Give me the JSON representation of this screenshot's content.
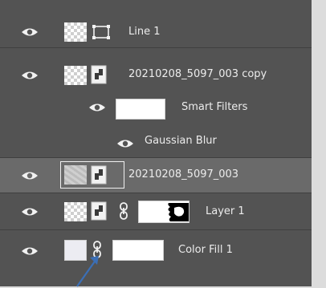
{
  "layers": [
    {
      "name": "Line 1"
    },
    {
      "name": "20210208_5097_003 copy"
    },
    {
      "name": "Smart Filters"
    },
    {
      "name": "Gaussian Blur"
    },
    {
      "name": "20210208_5097_003"
    },
    {
      "name": "Layer 1"
    },
    {
      "name": "Color Fill 1"
    }
  ],
  "icons": {
    "eye": "eye-icon",
    "vector": "vector-mask-icon",
    "smart_object": "smart-object-badge-icon",
    "link": "link-chain-icon",
    "cursor": "arrow-cursor-icon"
  },
  "colors": {
    "panel": "#535353",
    "selected_row": "#6a6a6a",
    "separator": "#3f3f3f",
    "text": "#ececec",
    "cursor": "#3b6fb6"
  }
}
